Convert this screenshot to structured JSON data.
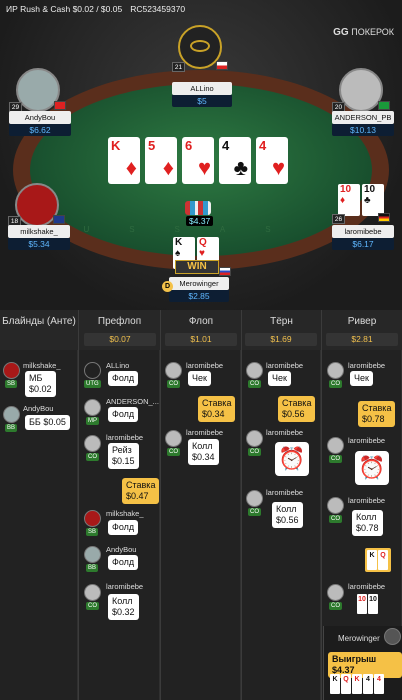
{
  "header": {
    "game": "ИР  Rush & Cash $0.02 / $0.05",
    "hand_id": "RC523459370"
  },
  "logo": {
    "brand": "GG",
    "text": "ПОКЕРОК"
  },
  "players": {
    "top": {
      "name": "ALLino",
      "stack": "$5",
      "level": "21"
    },
    "left_top": {
      "name": "AndyBou",
      "stack": "$6.62",
      "level": "29"
    },
    "right_top": {
      "name": "ANDERSON_PB",
      "stack": "$10.13",
      "level": "20"
    },
    "left_mid": {
      "name": "milkshake_",
      "stack": "$5.34",
      "level": "18"
    },
    "right_mid": {
      "name": "laromibebe",
      "stack": "$6.17",
      "level": "26",
      "cards": [
        "10",
        "10"
      ]
    },
    "hero": {
      "name": "Merowinger",
      "stack": "$2.85",
      "cards": [
        "K",
        "Q"
      ],
      "badge": "WIN",
      "dealer": "D"
    }
  },
  "board": [
    {
      "rank": "K",
      "suit": "♦",
      "color": "red"
    },
    {
      "rank": "5",
      "suit": "♦",
      "color": "red"
    },
    {
      "rank": "6",
      "suit": "♥",
      "color": "red"
    },
    {
      "rank": "4",
      "suit": "♣",
      "color": "black"
    },
    {
      "rank": "4",
      "suit": "♥",
      "color": "red"
    }
  ],
  "pot": "$4.37",
  "columns": [
    {
      "label": "Блайнды (Анте)",
      "pot": ""
    },
    {
      "label": "Префлоп",
      "pot": "$0.07"
    },
    {
      "label": "Флоп",
      "pot": "$1.01"
    },
    {
      "label": "Тёрн",
      "pot": "$1.69"
    },
    {
      "label": "Ривер",
      "pot": "$2.81"
    }
  ],
  "history": {
    "blinds": [
      {
        "name": "milkshake_",
        "pos": "SB",
        "action": "МБ\n$0.02"
      },
      {
        "name": "AndyBou",
        "pos": "BB",
        "action": "ББ $0.05"
      }
    ],
    "preflop": [
      {
        "name": "ALLino",
        "pos": "UTG",
        "action": "Фолд"
      },
      {
        "name": "ANDERSON_...",
        "pos": "MP",
        "action": "Фолд"
      },
      {
        "name": "laromibebe",
        "pos": "CO",
        "action": "Рейз\n$0.15"
      },
      {
        "name": "",
        "pos": "",
        "action": "Ставка\n$0.47"
      },
      {
        "name": "milkshake_",
        "pos": "SB",
        "action": "Фолд"
      },
      {
        "name": "AndyBou",
        "pos": "BB",
        "action": "Фолд"
      },
      {
        "name": "laromibebe",
        "pos": "CO",
        "action": "Колл\n$0.32"
      }
    ],
    "flop": [
      {
        "name": "laromibebe",
        "pos": "CO",
        "action": "Чек"
      },
      {
        "name": "",
        "pos": "",
        "action": "Ставка\n$0.34"
      },
      {
        "name": "laromibebe",
        "pos": "CO",
        "action": "Колл\n$0.34"
      }
    ],
    "turn": [
      {
        "name": "laromibebe",
        "pos": "CO",
        "action": "Чек"
      },
      {
        "name": "",
        "pos": "",
        "action": "Ставка\n$0.56"
      },
      {
        "name": "laromibebe",
        "pos": "CO",
        "action": "Колл\n$0.56"
      }
    ],
    "river": [
      {
        "name": "laromibebe",
        "pos": "CO",
        "action": "Чек"
      },
      {
        "name": "",
        "pos": "",
        "action": "Ставка\n$0.78"
      },
      {
        "name": "laromibebe",
        "pos": "CO",
        "action": "Колл\n$0.78"
      },
      {
        "name": "laromibebe",
        "pos": "CO",
        "action": ""
      }
    ],
    "winner": {
      "name": "Merowinger",
      "text": "Выигрыш $4.37"
    }
  },
  "colors": {
    "accent_gold": "#f5c146",
    "stack_blue": "#5fb7ff",
    "felt": "#2e7a42"
  }
}
